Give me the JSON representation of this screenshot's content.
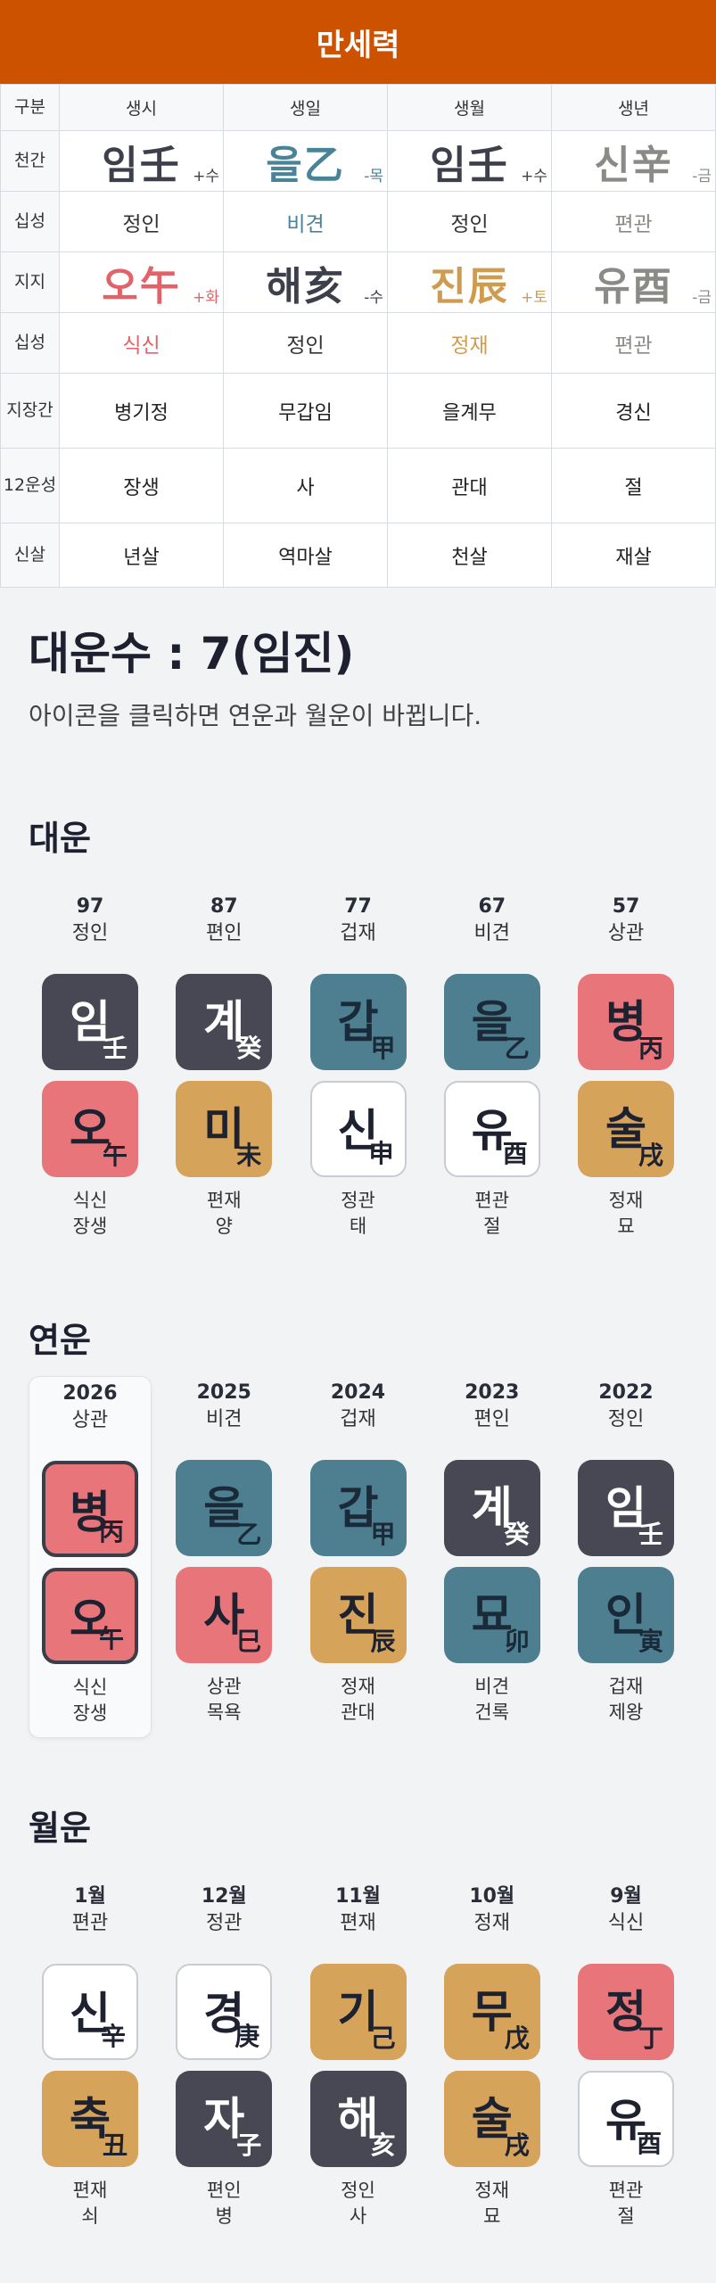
{
  "header": {
    "title": "만세력"
  },
  "pillars": {
    "head": [
      "구분",
      "생시",
      "생일",
      "생월",
      "생년"
    ],
    "labels": {
      "cheongan": "천간",
      "sipseong1": "십성",
      "jiji": "지지",
      "sipseong2": "십성",
      "jijanggan": "지장간",
      "unseong": "12운성",
      "sinsal": "신살"
    },
    "cheongan": [
      {
        "text": "임壬",
        "sup": "+수",
        "color": "#3d3f4a"
      },
      {
        "text": "을乙",
        "sup": "-목",
        "color": "#4a8396"
      },
      {
        "text": "임壬",
        "sup": "+수",
        "color": "#3d3f4a"
      },
      {
        "text": "신辛",
        "sup": "-금",
        "color": "#8a8a86"
      }
    ],
    "sipseong1": [
      {
        "text": "정인",
        "color": "#333333"
      },
      {
        "text": "비견",
        "color": "#4a8396"
      },
      {
        "text": "정인",
        "color": "#333333"
      },
      {
        "text": "편관",
        "color": "#8a8a86"
      }
    ],
    "jiji": [
      {
        "text": "오午",
        "sup": "+화",
        "color": "#e0636a"
      },
      {
        "text": "해亥",
        "sup": "-수",
        "color": "#3d3f4a"
      },
      {
        "text": "진辰",
        "sup": "+토",
        "color": "#cf9c4f"
      },
      {
        "text": "유酉",
        "sup": "-금",
        "color": "#8a8a86"
      }
    ],
    "sipseong2": [
      {
        "text": "식신",
        "color": "#e0636a"
      },
      {
        "text": "정인",
        "color": "#333333"
      },
      {
        "text": "정재",
        "color": "#cf9c4f"
      },
      {
        "text": "편관",
        "color": "#8a8a86"
      }
    ],
    "jijanggan": [
      "병기정",
      "무갑임",
      "을계무",
      "경신"
    ],
    "unseong": [
      "장생",
      "사",
      "관대",
      "절"
    ],
    "sinsal": [
      "년살",
      "역마살",
      "천살",
      "재살"
    ]
  },
  "daewoonsu": {
    "title": "대운수 : 7(임진)",
    "desc": "아이콘을 클릭하면 연운과 월운이 바뀝니다."
  },
  "daewoon": {
    "title": "대운",
    "items": [
      {
        "top1": "97",
        "top2": "정인",
        "stem": {
          "k": "임",
          "h": "壬",
          "bg": "dark"
        },
        "branch": {
          "k": "오",
          "h": "午",
          "bg": "red"
        },
        "bot1": "식신",
        "bot2": "장생"
      },
      {
        "top1": "87",
        "top2": "편인",
        "stem": {
          "k": "계",
          "h": "癸",
          "bg": "dark"
        },
        "branch": {
          "k": "미",
          "h": "未",
          "bg": "gold"
        },
        "bot1": "편재",
        "bot2": "양"
      },
      {
        "top1": "77",
        "top2": "겁재",
        "stem": {
          "k": "갑",
          "h": "甲",
          "bg": "teal"
        },
        "branch": {
          "k": "신",
          "h": "申",
          "bg": "white"
        },
        "bot1": "정관",
        "bot2": "태"
      },
      {
        "top1": "67",
        "top2": "비견",
        "stem": {
          "k": "을",
          "h": "乙",
          "bg": "teal"
        },
        "branch": {
          "k": "유",
          "h": "酉",
          "bg": "white"
        },
        "bot1": "편관",
        "bot2": "절"
      },
      {
        "top1": "57",
        "top2": "상관",
        "stem": {
          "k": "병",
          "h": "丙",
          "bg": "red"
        },
        "branch": {
          "k": "술",
          "h": "戌",
          "bg": "gold"
        },
        "bot1": "정재",
        "bot2": "묘"
      }
    ]
  },
  "yeonwoon": {
    "title": "연운",
    "items": [
      {
        "top1": "2026",
        "top2": "상관",
        "selected": true,
        "stem": {
          "k": "병",
          "h": "丙",
          "bg": "red"
        },
        "branch": {
          "k": "오",
          "h": "午",
          "bg": "red"
        },
        "bot1": "식신",
        "bot2": "장생"
      },
      {
        "top1": "2025",
        "top2": "비견",
        "stem": {
          "k": "을",
          "h": "乙",
          "bg": "teal"
        },
        "branch": {
          "k": "사",
          "h": "巳",
          "bg": "red"
        },
        "bot1": "상관",
        "bot2": "목욕"
      },
      {
        "top1": "2024",
        "top2": "겁재",
        "stem": {
          "k": "갑",
          "h": "甲",
          "bg": "teal"
        },
        "branch": {
          "k": "진",
          "h": "辰",
          "bg": "gold"
        },
        "bot1": "정재",
        "bot2": "관대"
      },
      {
        "top1": "2023",
        "top2": "편인",
        "stem": {
          "k": "계",
          "h": "癸",
          "bg": "dark"
        },
        "branch": {
          "k": "묘",
          "h": "卯",
          "bg": "teal"
        },
        "bot1": "비견",
        "bot2": "건록"
      },
      {
        "top1": "2022",
        "top2": "정인",
        "stem": {
          "k": "임",
          "h": "壬",
          "bg": "dark"
        },
        "branch": {
          "k": "인",
          "h": "寅",
          "bg": "teal"
        },
        "bot1": "겁재",
        "bot2": "제왕"
      }
    ]
  },
  "wolwoon": {
    "title": "월운",
    "items": [
      {
        "top1": "1월",
        "top2": "편관",
        "stem": {
          "k": "신",
          "h": "辛",
          "bg": "white"
        },
        "branch": {
          "k": "축",
          "h": "丑",
          "bg": "gold"
        },
        "bot1": "편재",
        "bot2": "쇠"
      },
      {
        "top1": "12월",
        "top2": "정관",
        "stem": {
          "k": "경",
          "h": "庚",
          "bg": "white"
        },
        "branch": {
          "k": "자",
          "h": "子",
          "bg": "dark"
        },
        "bot1": "편인",
        "bot2": "병"
      },
      {
        "top1": "11월",
        "top2": "편재",
        "stem": {
          "k": "기",
          "h": "己",
          "bg": "gold"
        },
        "branch": {
          "k": "해",
          "h": "亥",
          "bg": "dark"
        },
        "bot1": "정인",
        "bot2": "사"
      },
      {
        "top1": "10월",
        "top2": "정재",
        "stem": {
          "k": "무",
          "h": "戊",
          "bg": "gold"
        },
        "branch": {
          "k": "술",
          "h": "戌",
          "bg": "gold"
        },
        "bot1": "정재",
        "bot2": "묘"
      },
      {
        "top1": "9월",
        "top2": "식신",
        "stem": {
          "k": "정",
          "h": "丁",
          "bg": "red"
        },
        "branch": {
          "k": "유",
          "h": "酉",
          "bg": "white"
        },
        "bot1": "편관",
        "bot2": "절"
      }
    ]
  }
}
